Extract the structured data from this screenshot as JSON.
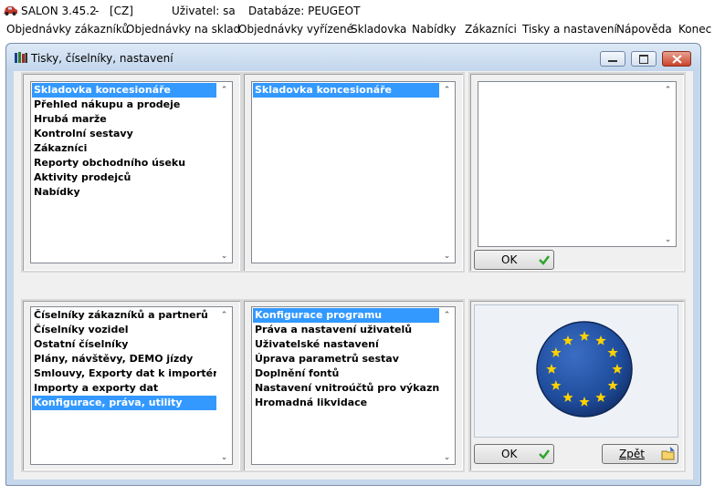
{
  "app": {
    "name": "SALON 3.45.2",
    "separator": "-",
    "locale": "[CZ]",
    "user": "Uživatel: sa",
    "database": "Databáze: PEUGEOT"
  },
  "menu": [
    "Objednávky zákazníků",
    "Objednávky na sklad",
    "Objednávky vyřízené",
    "Skladovka",
    "Nabídky",
    "Zákazníci",
    "Tisky a nastavení",
    "Nápověda",
    "Konec"
  ],
  "window": {
    "title": "Tisky, číselníky, nastavení"
  },
  "top_left_list": {
    "items": [
      "Skladovka koncesionáře",
      "Přehled nákupu a prodeje",
      "Hrubá marže",
      "Kontrolní sestavy",
      "Zákazníci",
      "Reporty obchodního úseku",
      "Aktivity prodejců",
      "Nabídky"
    ],
    "selected_index": 0
  },
  "top_mid_list": {
    "items": [
      "Skladovka koncesionáře"
    ],
    "selected_index": 0
  },
  "top_right_list": {
    "items": []
  },
  "bottom_left_list": {
    "items": [
      "Číselníky zákazníků a partnerů",
      "Číselníky vozidel",
      "Ostatní číselníky",
      "Plány, návštěvy, DEMO jízdy",
      "Smlouvy, Exporty dat k importérovi",
      "Importy a exporty dat",
      "Konfigurace, práva, utility"
    ],
    "selected_index": 6
  },
  "bottom_mid_list": {
    "items": [
      "Konfigurace programu",
      "Práva a nastavení uživatelů",
      "Uživatelské nastavení",
      "Úprava parametrů sestav",
      "Doplnění fontů",
      "Nastavení vnitroúčtů pro výkaznictví",
      "Hromadná likvidace"
    ],
    "selected_index": 0
  },
  "buttons": {
    "ok_top": "OK",
    "ok_bottom": "OK",
    "back": "Zpět"
  },
  "icons": {
    "minimize": "minimize-icon",
    "maximize": "maximize-icon",
    "close": "close-icon",
    "check": "check-icon",
    "folder": "folder-icon",
    "eu_flag": "eu-flag-icon"
  },
  "colors": {
    "selection": "#3399ff",
    "window_frame": "#c5d7eb",
    "eu_blue": "#1f4c9c",
    "eu_star": "#ffd200"
  }
}
